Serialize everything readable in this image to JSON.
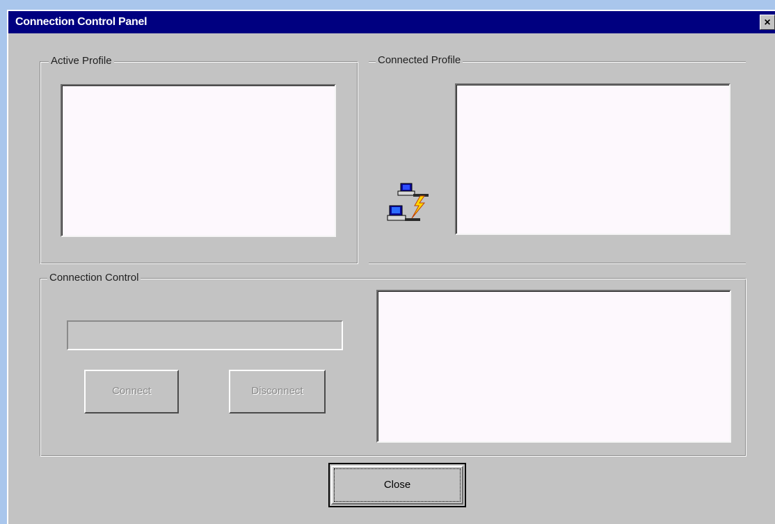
{
  "window": {
    "title": "Connection Control Panel",
    "close_glyph": "×"
  },
  "active_profile": {
    "legend": "Active Profile"
  },
  "connected_profile": {
    "legend": "Connected Profile",
    "icon": "network-connection-icon"
  },
  "connection_control": {
    "legend": "Connection Control",
    "connect_label": "Connect",
    "disconnect_label": "Disconnect"
  },
  "close_label": "Close",
  "colors": {
    "titlebar": "#000080",
    "window_face": "#c3c3c3",
    "desktop": "#a9c6ec",
    "listbox": "#fdf8fd"
  }
}
